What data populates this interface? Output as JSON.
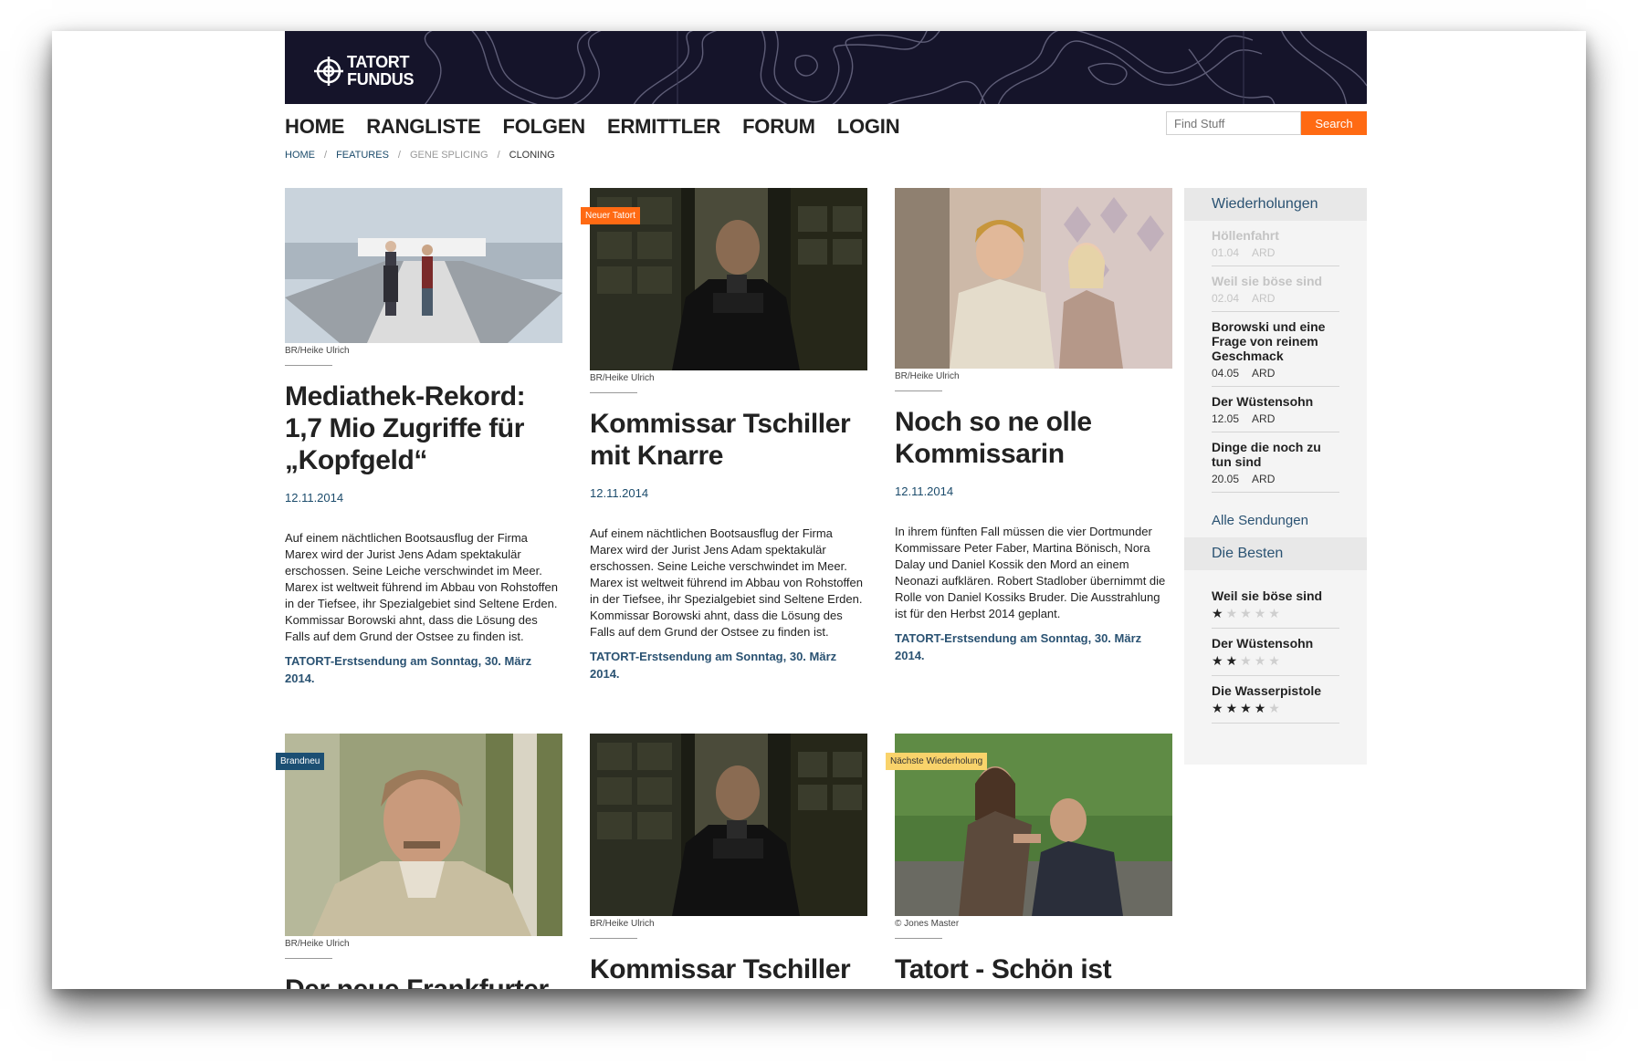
{
  "site": {
    "logo_line1": "TATORT",
    "logo_line2": "FUNDUS"
  },
  "nav": {
    "items": [
      "HOME",
      "RANGLISTE",
      "FOLGEN",
      "ERMITTLER",
      "FORUM",
      "LOGIN"
    ]
  },
  "search": {
    "placeholder": "Find Stuff",
    "button_label": "Search"
  },
  "breadcrumb": {
    "items": [
      "HOME",
      "FEATURES",
      "GENE SPLICING",
      "CLONING"
    ],
    "separator": "/"
  },
  "articles": [
    {
      "badge": "",
      "credit": "BR/Heike Ulrich",
      "title": "Mediathek-Rekord: 1,7 Mio Zugriffe für „Kopfgeld“",
      "date": "12.11.2014",
      "excerpt": "Auf einem nächtlichen Bootsausflug der Firma Marex wird der Jurist Jens Adam spektakulär erschossen. Seine Leiche verschwindet im Meer. Marex ist weltweit führend im Abbau von Rohstoffen in der Tiefsee, ihr Spezialgebiet sind Seltene Erden. Kommissar Borowski ahnt, dass die Lösung des Falls auf dem Grund der Ostsee zu finden ist.",
      "airing": "TATORT-Erstsendung am Sonntag, 30. März 2014."
    },
    {
      "badge": "Neuer Tatort",
      "credit": "BR/Heike Ulrich",
      "title": "Kommissar Tschiller mit Knarre",
      "date": "12.11.2014",
      "excerpt": "Auf einem nächtlichen Bootsausflug der Firma Marex wird der Jurist Jens Adam spektakulär erschossen. Seine Leiche verschwindet im Meer. Marex ist weltweit führend im Abbau von Rohstoffen in der Tiefsee, ihr Spezialgebiet sind Seltene Erden. Kommissar Borowski ahnt, dass die Lösung des Falls auf dem Grund der Ostsee zu finden ist.",
      "airing": "TATORT-Erstsendung am Sonntag, 30. März 2014."
    },
    {
      "badge": "",
      "credit": "BR/Heike Ulrich",
      "title": "Noch so ne olle Kommissarin",
      "date": "12.11.2014",
      "excerpt": "In ihrem fünften Fall müssen die vier Dortmunder Kommissare Peter Faber, Martina Bönisch, Nora Dalay und Daniel Kossik den Mord an einem Neonazi aufklären. Robert Stadlober übernimmt die Rolle von Daniel Kossiks Bruder. Die Ausstrahlung ist für den Herbst 2014 geplant.",
      "airing": "TATORT-Erstsendung am Sonntag, 30. März 2014."
    },
    {
      "badge": "Brandneu",
      "credit": "BR/Heike Ulrich",
      "title": "Der neue Frankfurter"
    },
    {
      "badge": "",
      "credit": "BR/Heike Ulrich",
      "title": "Kommissar Tschiller mit Knarre"
    },
    {
      "badge": "Nächste Wiederholung",
      "credit": "© Jones Master",
      "title": "Tatort - Schön ist anders"
    }
  ],
  "sidebar": {
    "repeats_heading": "Wiederholungen",
    "repeats": [
      {
        "title": "Höllenfahrt",
        "date": "01.04",
        "channel": "ARD",
        "past": true
      },
      {
        "title": "Weil sie böse sind",
        "date": "02.04",
        "channel": "ARD",
        "past": true
      },
      {
        "title": "Borowski und eine Frage von reinem Geschmack",
        "date": "04.05",
        "channel": "ARD",
        "past": false
      },
      {
        "title": "Der Wüstensohn",
        "date": "12.05",
        "channel": "ARD",
        "past": false
      },
      {
        "title": "Dinge die noch zu tun sind",
        "date": "20.05",
        "channel": "ARD",
        "past": false
      }
    ],
    "all_shows_link": "Alle Sendungen",
    "best_heading": "Die Besten",
    "best": [
      {
        "title": "Weil sie böse sind",
        "rating": 1,
        "max": 5
      },
      {
        "title": "Der Wüstensohn",
        "rating": 2,
        "max": 5
      },
      {
        "title": "Die Wasserpistole",
        "rating": 4,
        "max": 5
      }
    ]
  },
  "colors": {
    "accent": "#ff6a13",
    "banner": "#15142a",
    "link": "#1b4b6b",
    "badge_blue": "#1c4f73",
    "badge_yellow": "#f9d36b"
  }
}
